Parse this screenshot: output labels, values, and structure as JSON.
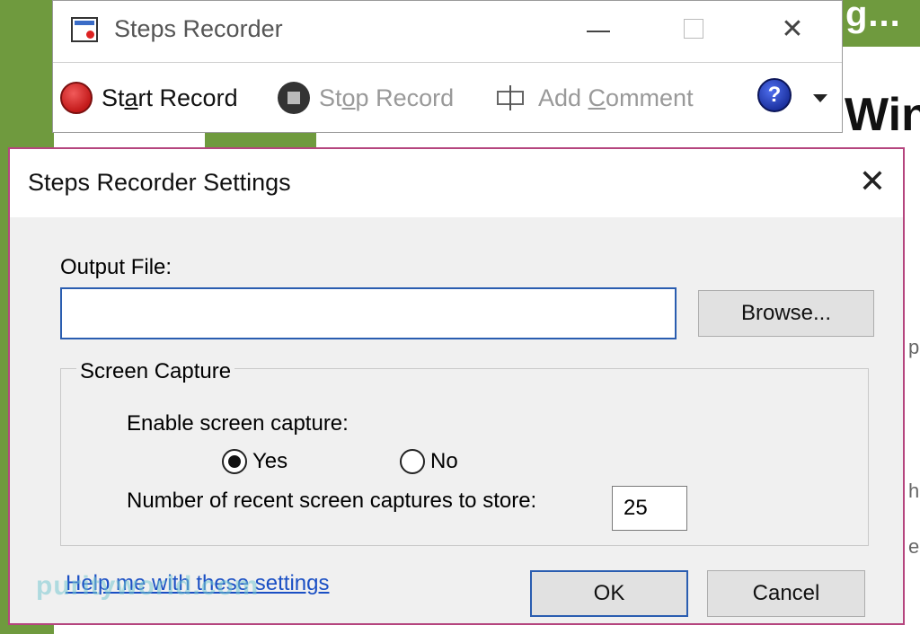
{
  "background": {
    "header_fragment": "g...",
    "heading_fragment": "Win",
    "edge_chars": [
      "p",
      "h",
      "e"
    ]
  },
  "recorder": {
    "title": "Steps Recorder",
    "toolbar": {
      "start_pre": "St",
      "start_key": "a",
      "start_post": "rt Record",
      "stop_pre": "St",
      "stop_key": "o",
      "stop_post": "p Record",
      "comment_pre": "Add ",
      "comment_key": "C",
      "comment_post": "omment",
      "help_glyph": "?"
    }
  },
  "dialog": {
    "title": "Steps Recorder Settings",
    "output_label": "Output File:",
    "output_value": "",
    "browse_label": "Browse...",
    "group_label": "Screen Capture",
    "enable_label": "Enable screen capture:",
    "yes_label": "Yes",
    "no_label": "No",
    "screen_capture_enabled": "Yes",
    "captures_label": "Number of recent screen captures to store:",
    "captures_value": "25",
    "help_link": "Help me with these settings",
    "ok_label": "OK",
    "cancel_label": "Cancel"
  },
  "watermark": "purityworld.com",
  "colors": {
    "accent_green": "#6f9a3e",
    "dialog_border": "#b5457e",
    "focus_blue": "#2a5db0",
    "link_blue": "#1a4fc4",
    "record_red": "#c31a1a"
  }
}
